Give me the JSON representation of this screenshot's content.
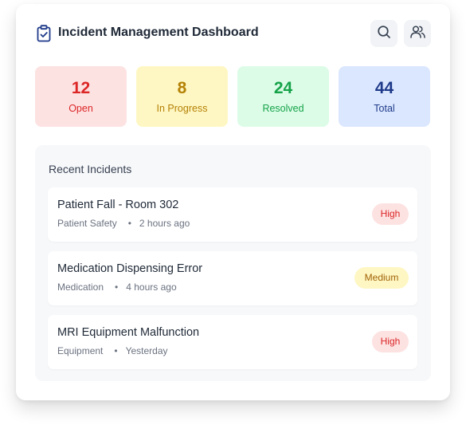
{
  "header": {
    "title": "Incident Management Dashboard",
    "icon": "clipboard-check-icon",
    "actions": [
      {
        "icon": "search-icon"
      },
      {
        "icon": "users-icon"
      }
    ]
  },
  "stats": {
    "open": {
      "value": "12",
      "label": "Open"
    },
    "in_progress": {
      "value": "8",
      "label": "In Progress"
    },
    "resolved": {
      "value": "24",
      "label": "Resolved"
    },
    "total": {
      "value": "44",
      "label": "Total"
    }
  },
  "recent": {
    "title": "Recent Incidents",
    "items": [
      {
        "title": "Patient Fall - Room 302",
        "category": "Patient Safety",
        "dot": "•",
        "time": "2 hours ago",
        "severity": "High"
      },
      {
        "title": "Medication Dispensing Error",
        "category": "Medication",
        "dot": "•",
        "time": "4 hours ago",
        "severity": "Medium"
      },
      {
        "title": "MRI Equipment Malfunction",
        "category": "Equipment",
        "dot": "•",
        "time": "Yesterday",
        "severity": "High"
      }
    ]
  },
  "colors": {
    "open": "#dc2626",
    "in_progress": "#b58105",
    "resolved": "#16a34a",
    "total": "#1e3a8a",
    "high_badge_bg": "#fde2e2",
    "medium_badge_bg": "#fef7c3"
  }
}
